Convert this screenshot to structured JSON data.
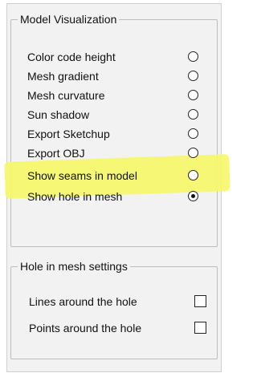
{
  "model_visualization": {
    "title": "Model Visualization",
    "options": [
      {
        "label": "Color code height",
        "checked": false
      },
      {
        "label": "Mesh gradient",
        "checked": false
      },
      {
        "label": "Mesh curvature",
        "checked": false
      },
      {
        "label": "Sun shadow",
        "checked": false
      },
      {
        "label": "Export Sketchup",
        "checked": false
      },
      {
        "label": "Export OBJ",
        "checked": false
      },
      {
        "label": "Show seams in model",
        "checked": false
      },
      {
        "label": "Show hole in mesh",
        "checked": true
      }
    ],
    "highlight_color": "#f6f86a"
  },
  "hole_settings": {
    "title": "Hole in mesh settings",
    "options": [
      {
        "label": "Lines around the hole",
        "checked": false
      },
      {
        "label": "Points around the hole",
        "checked": false
      }
    ]
  }
}
